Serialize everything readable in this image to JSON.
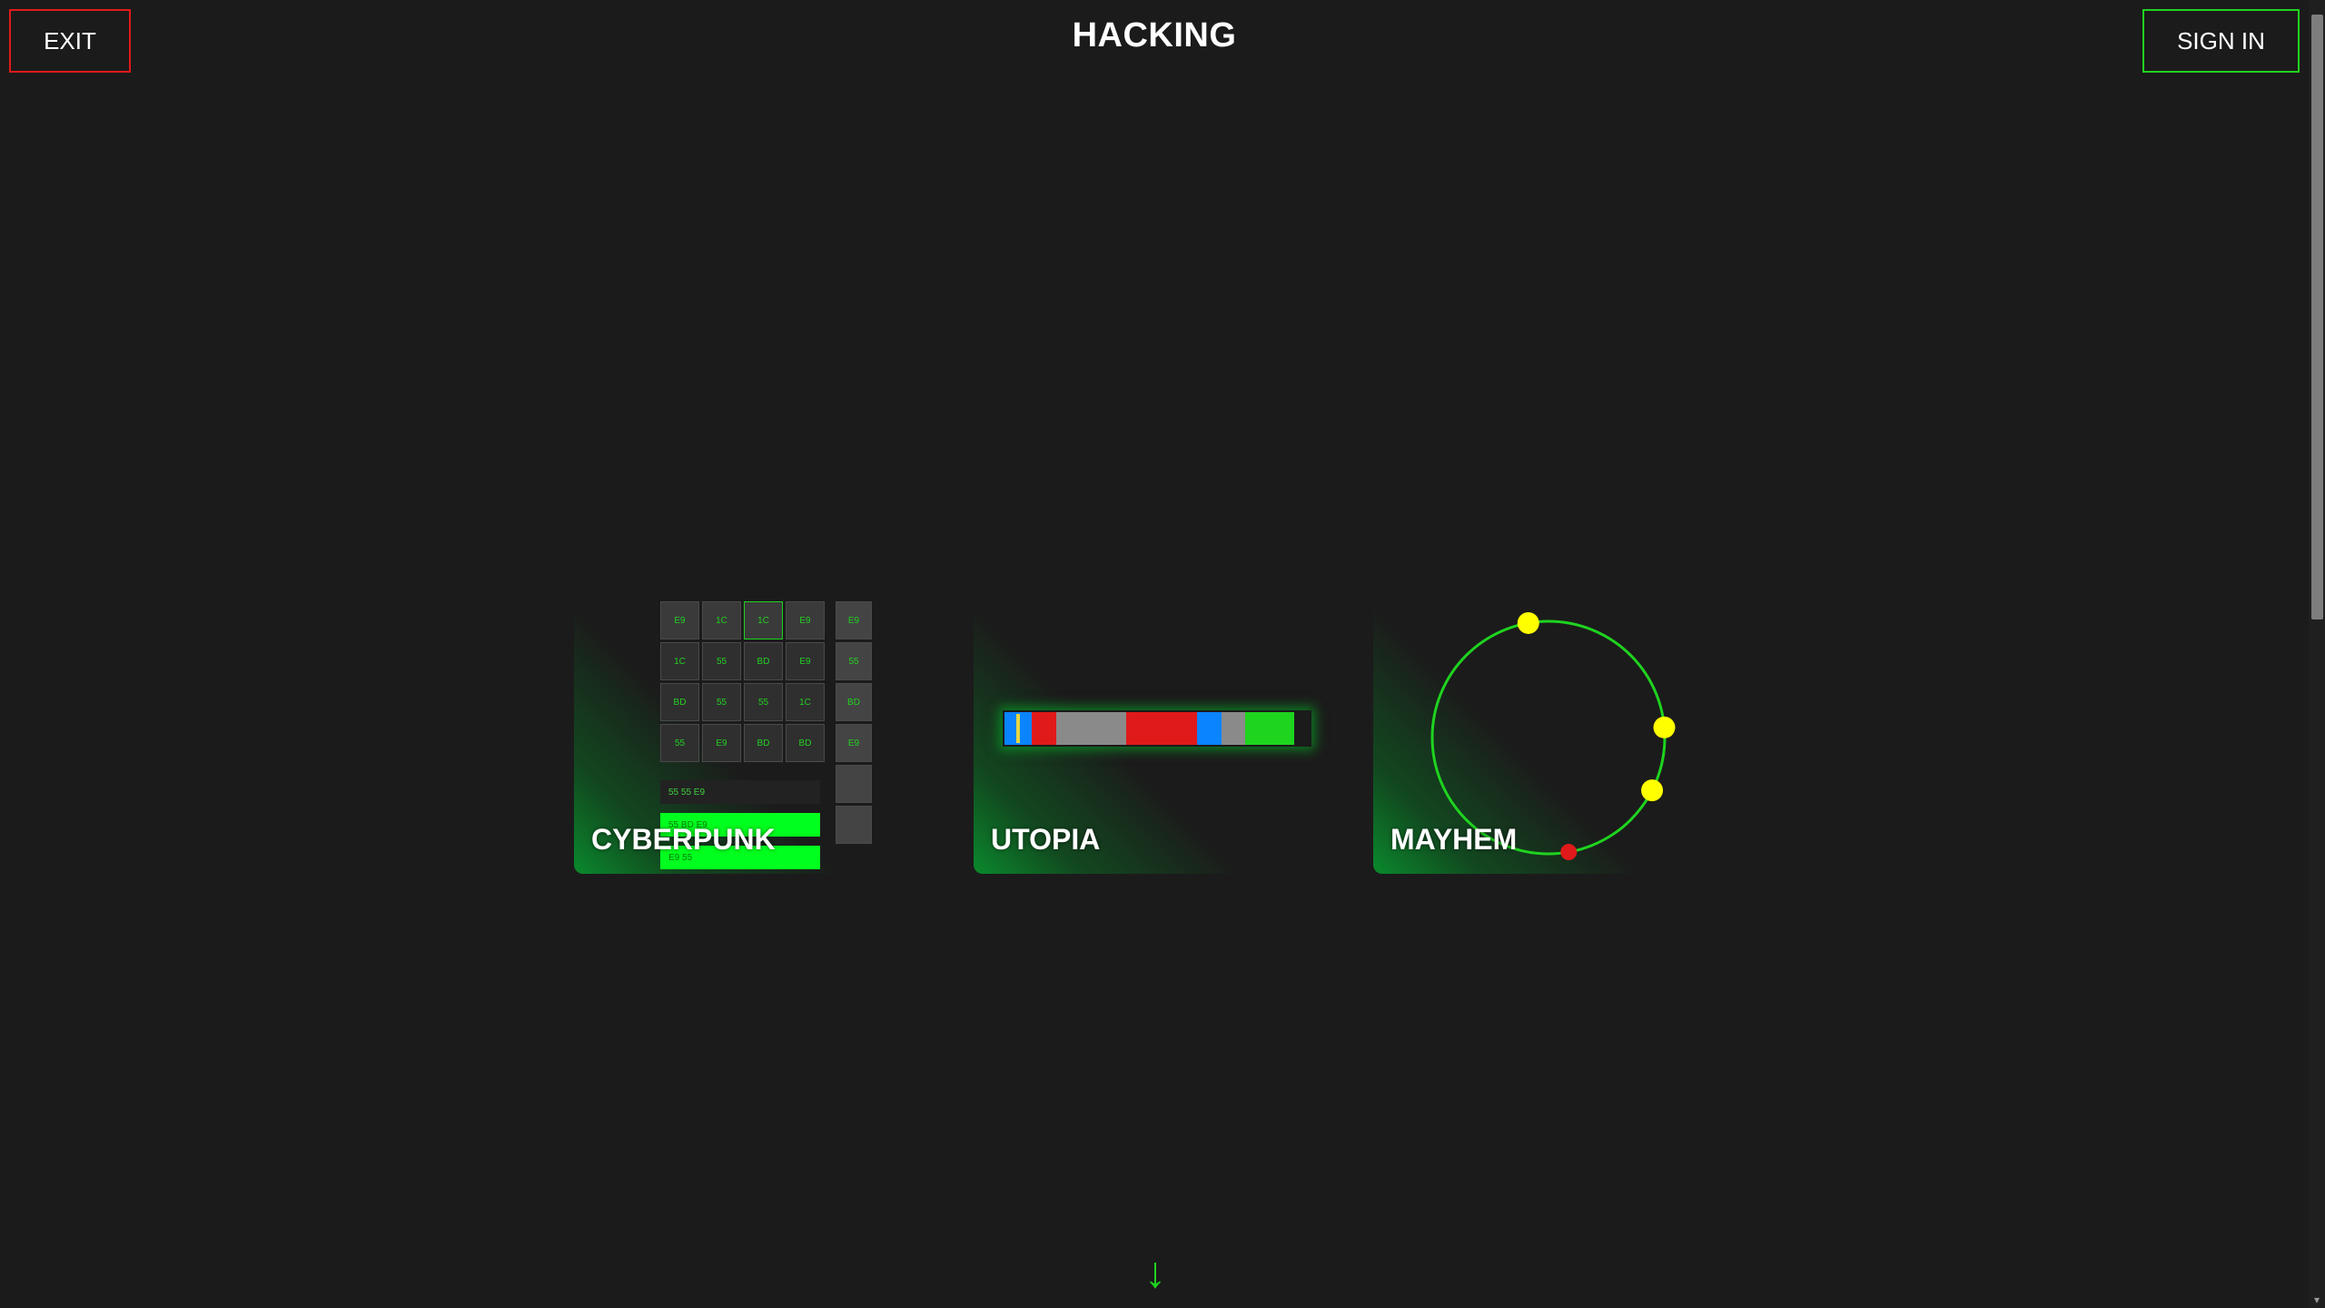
{
  "header": {
    "title": "HACKING",
    "exit_label": "EXIT",
    "signin_label": "SIGN IN"
  },
  "colors": {
    "background": "#1b1b1b",
    "accent_green": "#1fd31f",
    "exit_red": "#e01a1a",
    "node_yellow": "#ffff00",
    "node_red": "#e01a1a"
  },
  "cards": [
    {
      "label": "CYBERPUNK"
    },
    {
      "label": "UTOPIA"
    },
    {
      "label": "MAYHEM"
    }
  ],
  "cyberpunk": {
    "grid": [
      [
        "E9",
        "1C",
        "1C",
        "E9"
      ],
      [
        "1C",
        "55",
        "BD",
        "E9"
      ],
      [
        "BD",
        "55",
        "55",
        "1C"
      ],
      [
        "55",
        "E9",
        "BD",
        "BD"
      ]
    ],
    "side": [
      "E9",
      "55",
      "BD",
      "E9",
      "",
      ""
    ],
    "buffer": "55 55 E9",
    "sequences": [
      "55 BD E9",
      "E9 55"
    ]
  },
  "utopia": {
    "segments": [
      {
        "color": "#0a84ff",
        "share": 0.09
      },
      {
        "color": "#e01a1a",
        "share": 0.08
      },
      {
        "color": "#8a8a8a",
        "share": 0.23
      },
      {
        "color": "#e01a1a",
        "share": 0.23
      },
      {
        "color": "#0a84ff",
        "share": 0.08
      },
      {
        "color": "#8a8a8a",
        "share": 0.08
      },
      {
        "color": "#1ed41e",
        "share": 0.16
      }
    ]
  },
  "mayhem": {
    "ring_color": "#1fd31f",
    "nodes_deg": [
      {
        "angle": -100,
        "color": "#ffff00"
      },
      {
        "angle": -5,
        "color": "#ffff00"
      },
      {
        "angle": 27,
        "color": "#ffff00"
      },
      {
        "angle": 80,
        "color": "#e01a1a"
      }
    ]
  },
  "footer": {
    "scroll_hint_icon": "arrow-down-icon",
    "scroll_hint_glyph": "↓"
  }
}
